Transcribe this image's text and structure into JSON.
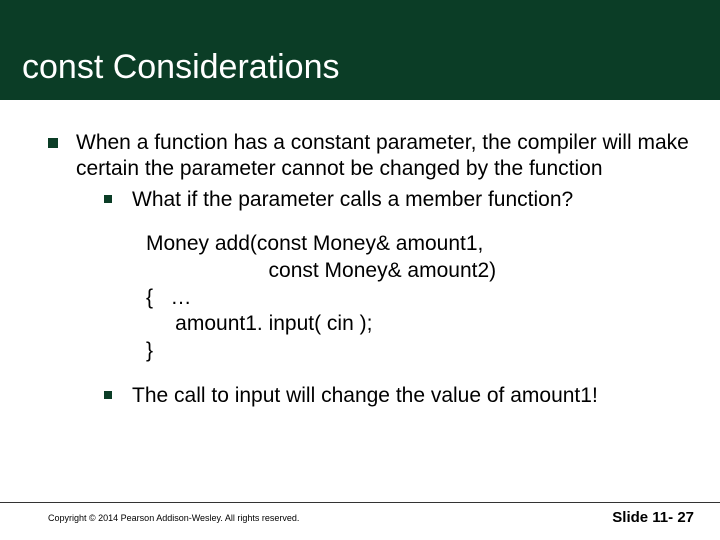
{
  "title": "const Considerations",
  "body": {
    "p1": "When a function has a constant parameter, the compiler will make certain the parameter cannot be changed by the function",
    "p1_sub1": "What if the parameter calls a member function?",
    "code_l1": "Money add(const Money& amount1,",
    "code_l2": "                     const Money& amount2)",
    "code_l3": "{   …",
    "code_l4": "     amount1. input( cin );",
    "code_l5": "}",
    "p1_sub2": "The call to input will change the value of amount1!"
  },
  "footer": {
    "copyright": "Copyright © 2014 Pearson Addison-Wesley.  All rights reserved.",
    "slide_label": "Slide 11- 27"
  }
}
